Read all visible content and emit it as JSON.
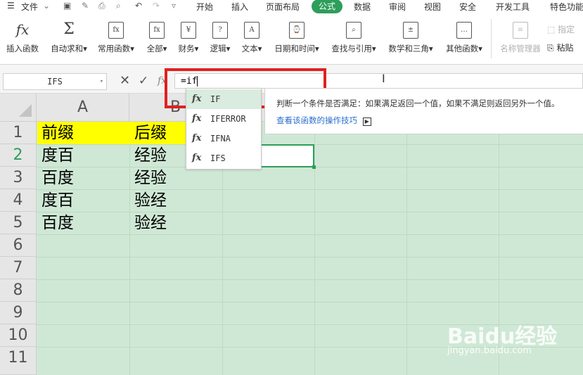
{
  "menubar": {
    "file": "文件",
    "tabs": [
      "开始",
      "插入",
      "页面布局",
      "公式",
      "数据",
      "审阅",
      "视图",
      "安全",
      "开发工具",
      "特色功能"
    ],
    "active_tab": "公式",
    "accent": "#2e9e5a"
  },
  "ribbon": {
    "buttons": [
      {
        "label": "插入函数",
        "icon": "fx"
      },
      {
        "label": "自动求和▾",
        "icon": "Σ"
      },
      {
        "label": "常用函数▾",
        "icon": "fx"
      },
      {
        "label": "全部▾",
        "icon": "fx"
      },
      {
        "label": "财务▾",
        "icon": "¥"
      },
      {
        "label": "逻辑▾",
        "icon": "?"
      },
      {
        "label": "文本▾",
        "icon": "A"
      },
      {
        "label": "日期和时间▾",
        "icon": "⌚"
      },
      {
        "label": "查找与引用▾",
        "icon": "⌕"
      },
      {
        "label": "数学和三角▾",
        "icon": "±"
      },
      {
        "label": "其他函数▾",
        "icon": "…"
      },
      {
        "label": "名称管理器",
        "icon": "≡"
      }
    ],
    "side": {
      "assign": "指定",
      "paste": "粘贴"
    }
  },
  "formulabar": {
    "name_box": "IFS",
    "fx": "fx",
    "formula": "=if"
  },
  "sheet": {
    "columns": [
      "A",
      "B"
    ],
    "rows": [
      "1",
      "2",
      "3",
      "4",
      "5",
      "6",
      "7",
      "8",
      "9",
      "10",
      "11"
    ],
    "cells": [
      [
        "前缀",
        "后缀"
      ],
      [
        "度百",
        "经验"
      ],
      [
        "百度",
        "经验"
      ],
      [
        "度百",
        "验经"
      ],
      [
        "百度",
        "验经"
      ]
    ],
    "header_highlight": "#ffff00"
  },
  "autocomplete": {
    "items": [
      "IF",
      "IFERROR",
      "IFNA",
      "IFS"
    ],
    "selected": "IF"
  },
  "tooltip": {
    "description": "判断一个条件是否满足：如果满足返回一个值，如果不满足则返回另外一个值。",
    "link": "查看该函数的操作技巧"
  },
  "watermark": {
    "brand": "Baidu经验",
    "url": "jingyan.baidu.com"
  }
}
